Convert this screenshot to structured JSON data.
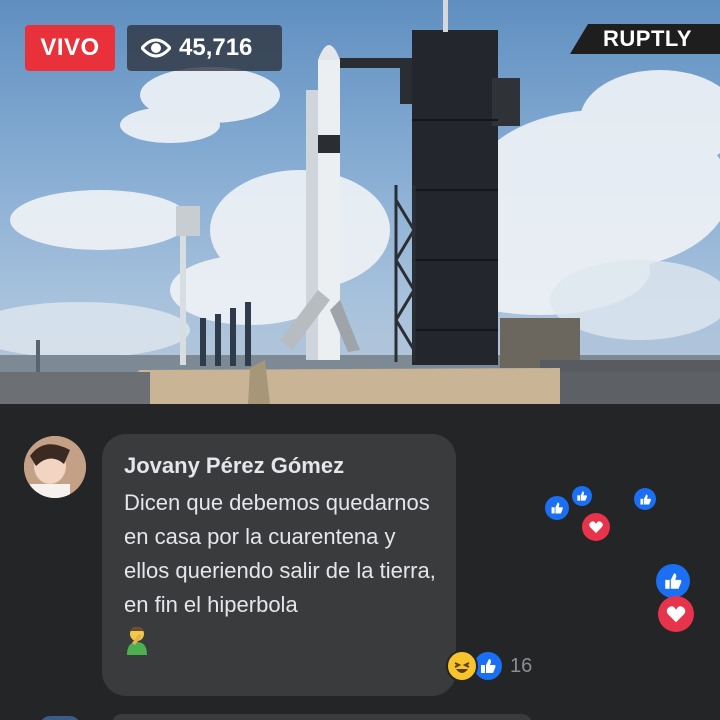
{
  "video": {
    "live_label": "VIVO",
    "viewer_count": "45,716",
    "watermark": "RUPTLY"
  },
  "comment": {
    "author": "Jovany Pérez Gómez",
    "text": "Dicen que debemos quedarnos en casa por la cuarentena y ellos queriendo salir de la tierra, en fin el hiperbola",
    "reaction_count": "16",
    "reactions": [
      "haha",
      "like"
    ]
  },
  "floating_reactions": [
    "like",
    "like",
    "love",
    "like",
    "like",
    "love",
    "like"
  ],
  "colors": {
    "live_red": "#e8313a",
    "facebook_blue": "#1a6ff5",
    "love_red": "#e8334d",
    "background": "#242526",
    "bubble": "#3a3b3c"
  }
}
